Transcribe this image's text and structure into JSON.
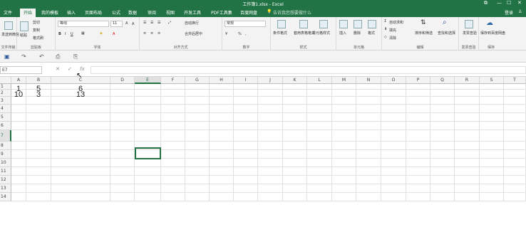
{
  "titlebar": {
    "title": "工作簿1.xlsx - Excel",
    "restore_icon": "restore-icon",
    "minimize": "—",
    "maximize": "☐",
    "close": "✕"
  },
  "tabs": [
    "文件",
    "开始",
    "我的模板",
    "插入",
    "页面布局",
    "公式",
    "数据",
    "审阅",
    "视图",
    "开发工具",
    "PDF工具集",
    "百度网盘"
  ],
  "tellme": "告诉我您想要做什么",
  "login": "登录",
  "ribbon": {
    "clipboard": {
      "label": "剪贴板",
      "send": "发送到微信",
      "paste": "粘贴",
      "cut": "剪切",
      "copy": "复制",
      "format_painter": "格式刷"
    },
    "wechat_label": "文件传输",
    "font": {
      "label": "字体",
      "name": "等线",
      "size": "11",
      "bold": "B",
      "italic": "I",
      "underline": "U",
      "grow": "A",
      "shrink": "A",
      "font_color": "A"
    },
    "alignment": {
      "label": "对齐方式",
      "wrap": "自动换行",
      "merge": "合并后居中"
    },
    "number": {
      "label": "数字",
      "format": "常规",
      "percent": "%",
      "comma": ","
    },
    "styles": {
      "label": "样式",
      "conditional": "条件格式",
      "table": "套用表格格式",
      "cell_styles": "单元格样式"
    },
    "cells": {
      "label": "单元格",
      "insert": "插入",
      "delete": "删除",
      "format": "格式"
    },
    "editing": {
      "label": "编辑",
      "autosum": "自动求和",
      "fill": "填充",
      "clear": "清除",
      "sort": "排序和筛选",
      "find": "查找和选择"
    },
    "invoice": {
      "label": "发票查验",
      "btn": "发票查验"
    },
    "save": {
      "label": "保存",
      "btn": "保存到百度网盘"
    }
  },
  "namebox": "E7",
  "fx": "fx",
  "columns": [
    "A",
    "B",
    "C",
    "D",
    "E",
    "F",
    "G",
    "H",
    "I",
    "J",
    "K",
    "L",
    "M",
    "N",
    "O",
    "P",
    "Q",
    "R",
    "S",
    "T"
  ],
  "rows": [
    "1",
    "2",
    "3",
    "4",
    "5",
    "6",
    "7",
    "8",
    "9",
    "10",
    "11",
    "12",
    "13",
    "14"
  ],
  "cells": {
    "A1": "1",
    "B1": "5",
    "C1": "6",
    "A2": "10",
    "B2": "3",
    "C2": "13"
  },
  "colors": {
    "accent": "#217346"
  }
}
